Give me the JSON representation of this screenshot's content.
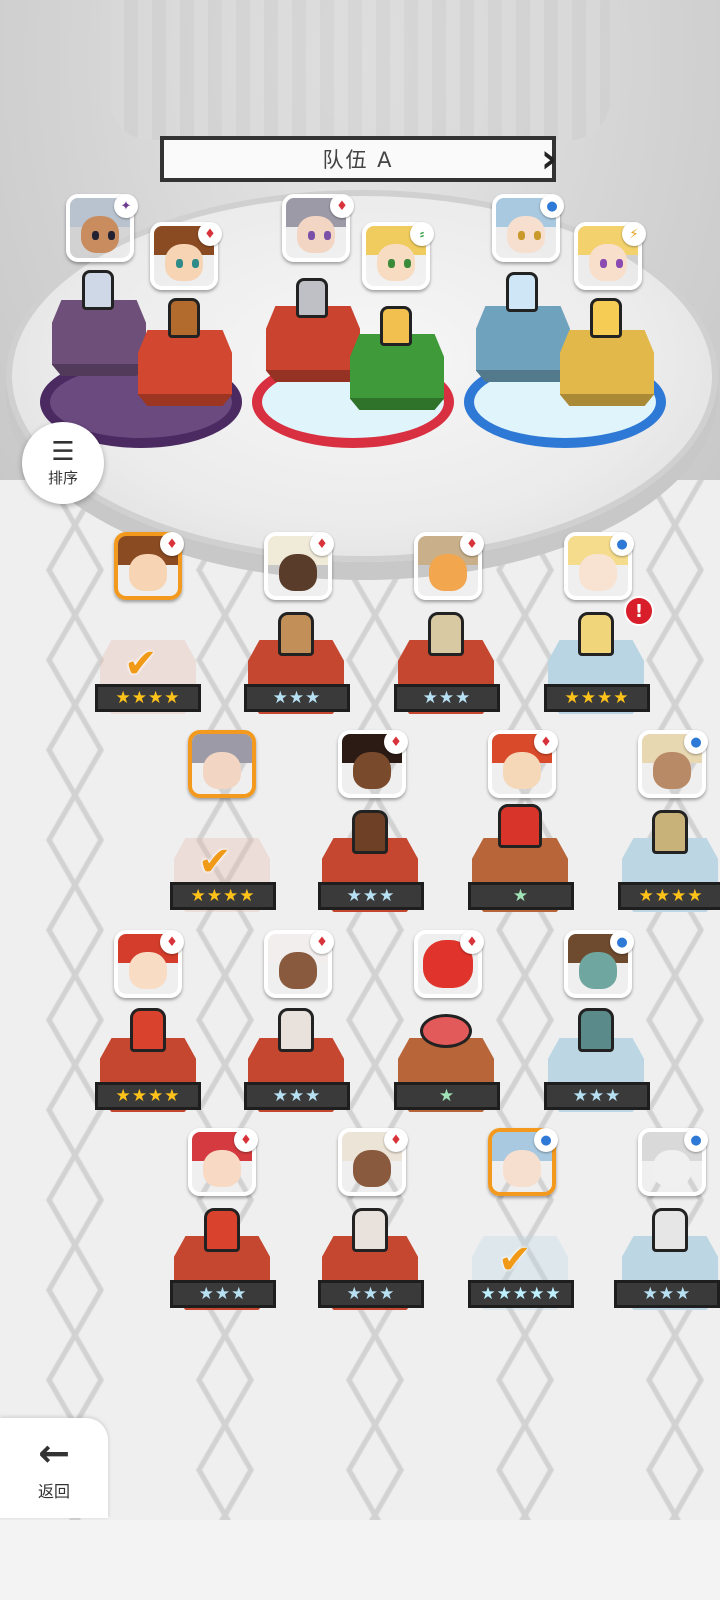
{
  "team": {
    "title": "队伍 A",
    "prev_icon": "chevron-left-icon",
    "next_icon": "chevron-right-icon"
  },
  "sort": {
    "label": "排序",
    "icon": "sort-icon"
  },
  "back": {
    "label": "返回",
    "icon": "arrow-left-icon"
  },
  "colors": {
    "fire": "#c7372c",
    "water": "#3d8fe0",
    "dark": "#6d3a8e",
    "earth": "#e8c24a",
    "selected": "#f39a1e"
  },
  "team_slots": [
    {
      "element": "dark",
      "element_icon": "dark-star-icon"
    },
    {
      "element": "fire",
      "element_icon": "fire-icon"
    },
    {
      "element": "fire",
      "element_icon": "fire-icon"
    },
    {
      "element": "earth",
      "element_icon": "leaf-icon"
    },
    {
      "element": "water",
      "element_icon": "water-icon"
    },
    {
      "element": "light",
      "element_icon": "lightning-icon"
    }
  ],
  "roster": [
    {
      "element": "fire",
      "stars": "★★★★",
      "tier": "gold",
      "selected": true
    },
    {
      "element": "fire",
      "stars": "★★★",
      "tier": "silver",
      "selected": false
    },
    {
      "element": "fire",
      "stars": "★★★",
      "tier": "silver",
      "selected": false
    },
    {
      "element": "water",
      "stars": "★★★★",
      "tier": "gold",
      "selected": false,
      "alert": "!"
    },
    {
      "element": "fire",
      "stars": "★★★★",
      "tier": "gold",
      "selected": true
    },
    {
      "element": "fire",
      "stars": "★★★",
      "tier": "silver",
      "selected": false
    },
    {
      "element": "fire",
      "stars": "★",
      "tier": "green",
      "selected": false
    },
    {
      "element": "water",
      "stars": "★★★★",
      "tier": "gold",
      "selected": false
    },
    {
      "element": "fire",
      "stars": "★★★★",
      "tier": "gold",
      "selected": false
    },
    {
      "element": "fire",
      "stars": "★★★",
      "tier": "silver",
      "selected": false
    },
    {
      "element": "fire",
      "stars": "★",
      "tier": "green",
      "selected": false
    },
    {
      "element": "water",
      "stars": "★★★",
      "tier": "silver",
      "selected": false
    },
    {
      "element": "fire",
      "stars": "★★★",
      "tier": "silver",
      "selected": false
    },
    {
      "element": "fire",
      "stars": "★★★",
      "tier": "silver",
      "selected": false
    },
    {
      "element": "water",
      "stars": "★★★★★",
      "tier": "rainbow",
      "selected": true
    },
    {
      "element": "water",
      "stars": "★★★",
      "tier": "silver",
      "selected": false
    }
  ]
}
